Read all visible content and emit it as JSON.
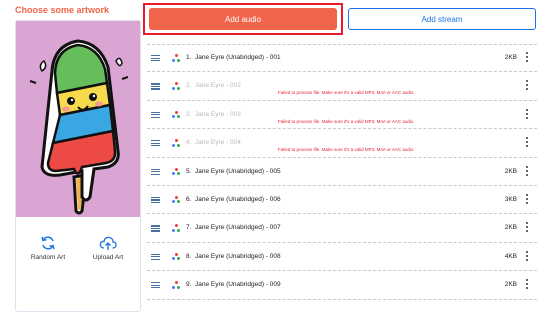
{
  "artwork": {
    "title": "Choose some artwork",
    "random_label": "Random Art",
    "upload_label": "Upload Art"
  },
  "buttons": {
    "add_audio": "Add audio",
    "add_stream": "Add stream"
  },
  "colors": {
    "accent": "#f06449",
    "highlight": "#e81c2c",
    "link": "#1a73e8",
    "art_bg": "#dba5d3"
  },
  "tracks": [
    {
      "num": "1.",
      "title": "Jane Eyre (Unabridged) - 001",
      "size": "2KB",
      "failed": false,
      "error": ""
    },
    {
      "num": "2.",
      "title": "Jane Eyre - 002",
      "size": "",
      "failed": true,
      "error": "Failed to process file. Make sure it's a valid MP3, M4A or AAC audio"
    },
    {
      "num": "3.",
      "title": "Jane Eyre - 003",
      "size": "",
      "failed": true,
      "error": "Failed to process file. Make sure it's a valid MP3, M4A or AAC audio"
    },
    {
      "num": "4.",
      "title": "Jane Eyre - 004",
      "size": "",
      "failed": true,
      "error": "Failed to process file. Make sure it's a valid MP3, M4A or AAC audio"
    },
    {
      "num": "5.",
      "title": "Jane Eyre (Unabridged) - 005",
      "size": "2KB",
      "failed": false,
      "error": ""
    },
    {
      "num": "6.",
      "title": "Jane Eyre (Unabridged) - 006",
      "size": "3KB",
      "failed": false,
      "error": ""
    },
    {
      "num": "7.",
      "title": "Jane Eyre (Unabridged) - 007",
      "size": "2KB",
      "failed": false,
      "error": ""
    },
    {
      "num": "8.",
      "title": "Jane Eyre (Unabridged) - 008",
      "size": "4KB",
      "failed": false,
      "error": ""
    },
    {
      "num": "9.",
      "title": "Jane Eyre (Unabridged) - 009",
      "size": "2KB",
      "failed": false,
      "error": ""
    }
  ]
}
